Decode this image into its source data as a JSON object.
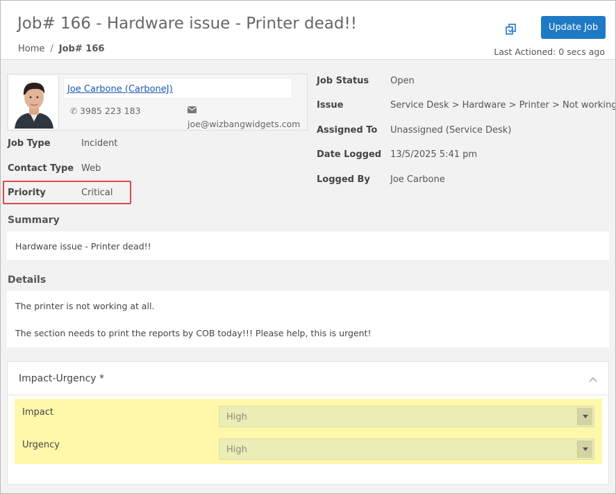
{
  "header": {
    "title": "Job# 166 - Hardware issue - Printer dead!!",
    "breadcrumb": {
      "home": "Home",
      "separator": "/",
      "current": "Job# 166"
    },
    "update_button": "Update Job",
    "last_actioned": "Last Actioned: 0 secs ago"
  },
  "contact": {
    "name": "Joe Carbone (CarboneJ)",
    "phone": "3985 223 183",
    "email": "joe@wizbangwidgets.com"
  },
  "left_fields": [
    {
      "label": "Job Type",
      "value": "Incident"
    },
    {
      "label": "Contact Type",
      "value": "Web"
    },
    {
      "label": "Priority",
      "value": "Critical"
    }
  ],
  "right_fields": [
    {
      "label": "Job Status",
      "value": "Open"
    },
    {
      "label": "Issue",
      "value": "Service Desk > Hardware > Printer > Not working"
    },
    {
      "label": "Assigned To",
      "value": "Unassigned (Service Desk)"
    },
    {
      "label": "Date Logged",
      "value": "13/5/2025 5:41 pm"
    },
    {
      "label": "Logged By",
      "value": "Joe Carbone"
    }
  ],
  "summary": {
    "heading": "Summary",
    "text": "Hardware issue - Printer dead!!"
  },
  "details": {
    "heading": "Details",
    "line1": "The printer is not working at all.",
    "line2": "The section needs to print the reports by COB today!!!  Please help, this is urgent!"
  },
  "impact_urgency": {
    "title": "Impact-Urgency *",
    "impact": {
      "label": "Impact",
      "value": "High"
    },
    "urgency": {
      "label": "Urgency",
      "value": "High"
    }
  },
  "colors": {
    "primary_button": "#1f7ac6",
    "priority_highlight": "#e0474c",
    "iu_highlight": "#fff8ab"
  }
}
